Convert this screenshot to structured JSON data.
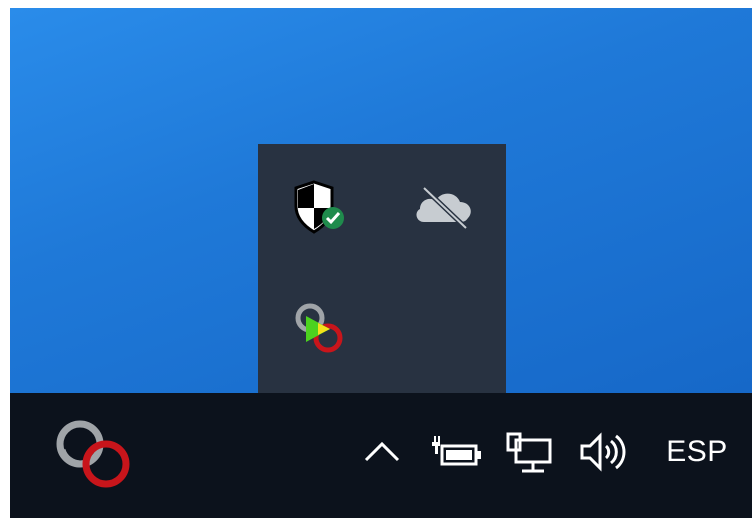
{
  "desktop": {
    "background_color": "#1f79d8"
  },
  "taskbar": {
    "background_color": "#0c121c",
    "pinned_app_icon": "linked-rings-app-icon",
    "tray": {
      "show_hidden_icons": "chevron-up-icon",
      "icons": [
        "power-battery-icon",
        "network-icon",
        "volume-icon"
      ],
      "language_label": "ESP"
    }
  },
  "tray_flyout": {
    "background_color": "#283241",
    "icons": [
      "windows-security-shield-icon",
      "onedrive-offline-icon",
      "app-play-icon"
    ]
  },
  "colors": {
    "security_green": "#1f8b4c",
    "ring_red": "#c8151b",
    "ring_gray": "#a0a4a8",
    "play_green": "#4cd21f",
    "play_yellow": "#f5e11a"
  }
}
